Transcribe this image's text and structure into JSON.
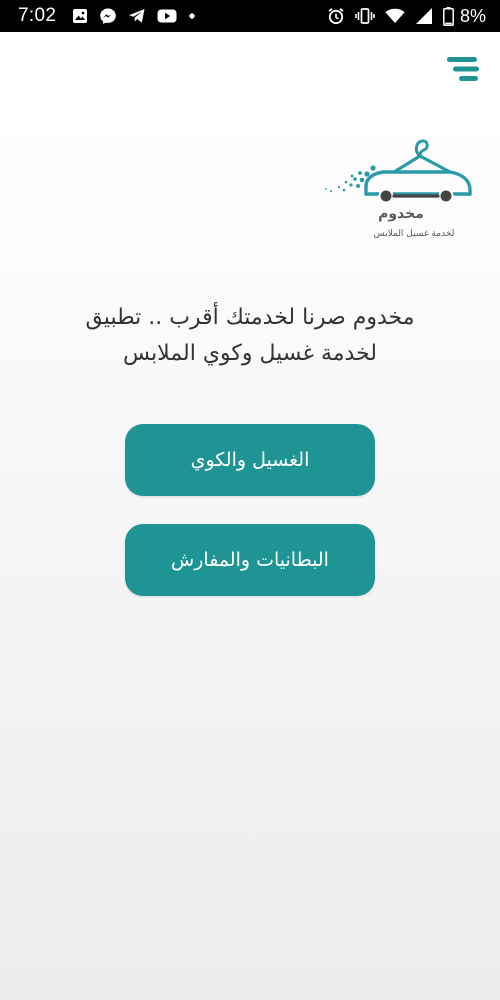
{
  "status_bar": {
    "time": "7:02",
    "battery": "8%",
    "left_icons": [
      "gallery-icon",
      "messenger-icon",
      "telegram-icon",
      "youtube-icon",
      "dot-icon"
    ],
    "right_icons": [
      "alarm-icon",
      "vibrate-icon",
      "wifi-icon",
      "signal-icon",
      "battery-icon"
    ]
  },
  "header": {
    "menu_icon": "menu-icon"
  },
  "logo": {
    "name": "مخدوم",
    "tagline": "لخدمة غسيل الملابس",
    "icon": "car-hanger-logo",
    "accent": "#2a9aa8"
  },
  "intro": {
    "line1": "مخدوم صرنا لخدمتك أقرب .. تطبيق",
    "line2": "لخدمة غسيل وكوي الملابس"
  },
  "buttons": {
    "washing_label": "الغسيل والكوي",
    "blankets_label": "البطانيات والمفارش",
    "color": "#1f9494"
  }
}
